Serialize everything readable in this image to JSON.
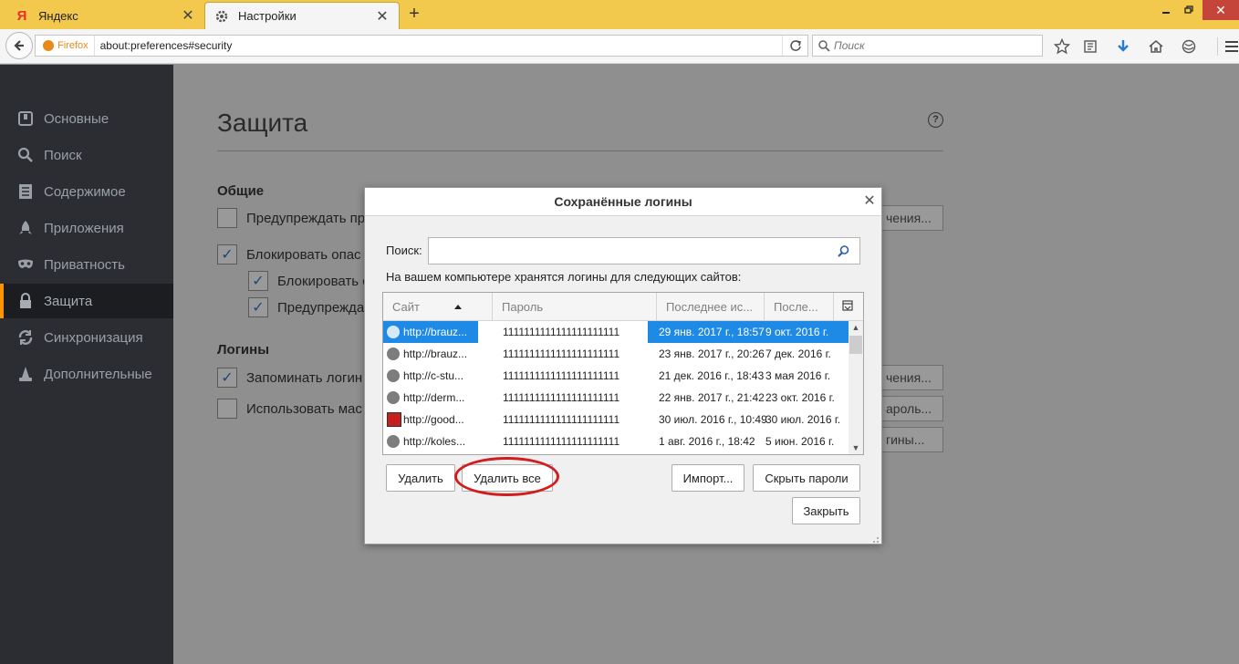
{
  "browser": {
    "tabs": [
      {
        "label": "Яндекс",
        "icon": "yandex-logo-icon",
        "active": false
      },
      {
        "label": "Настройки",
        "icon": "gear-icon",
        "active": true
      }
    ],
    "identity_label": "Firefox",
    "url": "about:preferences#security",
    "search_placeholder": "Поиск",
    "accent_color": "#f2c94c"
  },
  "sidebar": {
    "items": [
      {
        "label": "Основные",
        "icon": "switch-icon"
      },
      {
        "label": "Поиск",
        "icon": "search-icon"
      },
      {
        "label": "Содержимое",
        "icon": "document-icon"
      },
      {
        "label": "Приложения",
        "icon": "rocket-icon"
      },
      {
        "label": "Приватность",
        "icon": "mask-icon"
      },
      {
        "label": "Защита",
        "icon": "lock-icon",
        "selected": true
      },
      {
        "label": "Синхронизация",
        "icon": "sync-icon"
      },
      {
        "label": "Дополнительные",
        "icon": "wizard-icon"
      }
    ]
  },
  "main": {
    "title": "Защита",
    "general_heading": "Общие",
    "general_items": [
      {
        "label": "Предупреждать пр",
        "checked": false
      },
      {
        "label": "Блокировать опас",
        "checked": true
      },
      {
        "label": "Блокировать с",
        "checked": true
      },
      {
        "label": "Предупрежда",
        "checked": true
      }
    ],
    "logins_heading": "Логины",
    "logins_items": [
      {
        "label": "Запоминать логин",
        "checked": true
      },
      {
        "label": "Использовать мас",
        "checked": false
      }
    ],
    "bg_buttons": [
      "чения...",
      "чения...",
      "ароль...",
      "гины..."
    ]
  },
  "dialog": {
    "title": "Сохранённые логины",
    "search_label": "Поиск:",
    "search_value": "",
    "info": "На вашем компьютере хранятся логины для следующих сайтов:",
    "columns": [
      "Сайт",
      "Пароль",
      "Последнее ис...",
      "После..."
    ],
    "rows": [
      {
        "site": "http://brauz...",
        "password": "1111111111111111111111",
        "last_used": "29 янв. 2017 г., 18:57",
        "changed": "9 окт. 2016 г.",
        "icon": "globe-icon",
        "selected": true
      },
      {
        "site": "http://brauz...",
        "password": "1111111111111111111111",
        "last_used": "23 янв. 2017 г., 20:26",
        "changed": "7 дек. 2016 г.",
        "icon": "globe-icon"
      },
      {
        "site": "http://c-stu...",
        "password": "1111111111111111111111",
        "last_used": "21 дек. 2016 г., 18:43",
        "changed": "3 мая 2016 г.",
        "icon": "globe-icon"
      },
      {
        "site": "http://derm...",
        "password": "1111111111111111111111",
        "last_used": "22 янв. 2017 г., 21:42",
        "changed": "23 окт. 2016 г.",
        "icon": "globe-icon"
      },
      {
        "site": "http://good...",
        "password": "1111111111111111111111",
        "last_used": "30 июл. 2016 г., 10:49",
        "changed": "30 июл. 2016 г.",
        "icon": "site-favicon-icon"
      },
      {
        "site": "http://koles...",
        "password": "1111111111111111111111",
        "last_used": "1 авг. 2016 г., 18:42",
        "changed": "5 июн. 2016 г.",
        "icon": "globe-icon"
      }
    ],
    "buttons": {
      "remove": "Удалить",
      "remove_all": "Удалить все",
      "import": "Импорт...",
      "hide_passwords": "Скрыть пароли",
      "close": "Закрыть"
    },
    "highlight_color": "#d11d1d",
    "selection_color": "#1e8ae6"
  }
}
